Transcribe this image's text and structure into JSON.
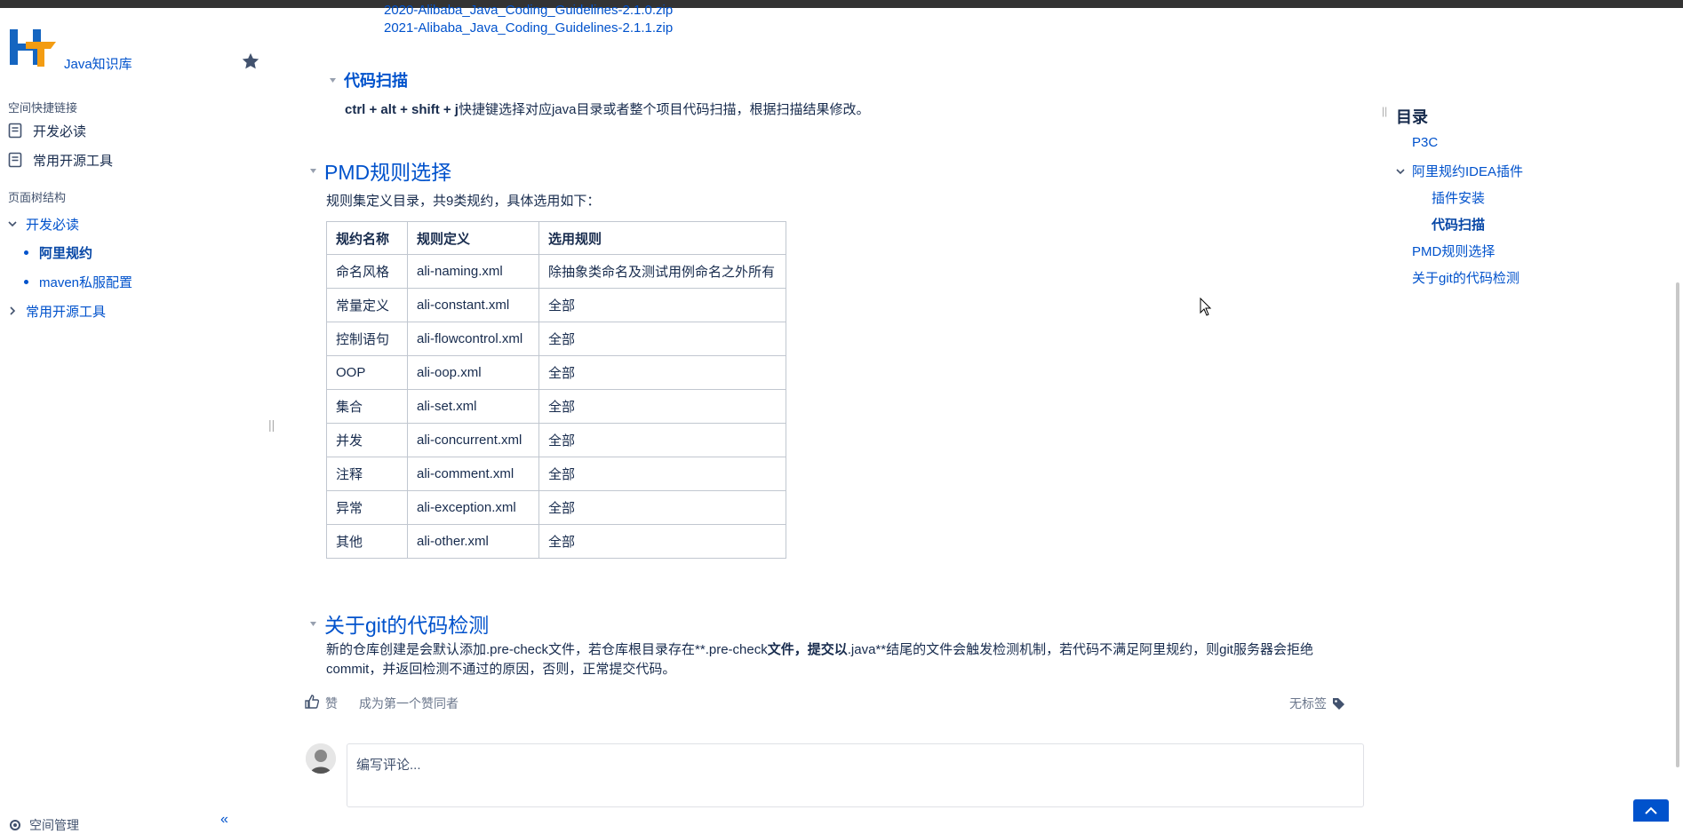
{
  "space": {
    "name": "Java知识库",
    "favorite_icon": "star-icon"
  },
  "sidebar": {
    "quick_links_title": "空间快捷链接",
    "quick_links": [
      {
        "label": "开发必读",
        "icon": "page-icon"
      },
      {
        "label": "常用开源工具",
        "icon": "page-icon"
      }
    ],
    "tree_title": "页面树结构",
    "tree": [
      {
        "label": "开发必读",
        "expanded": true
      },
      {
        "label": "阿里规约",
        "active": true
      },
      {
        "label": "maven私服配置"
      },
      {
        "label": "常用开源工具",
        "expanded": false
      }
    ],
    "footer_label": "空间管理"
  },
  "content": {
    "attachments": [
      "2020-Alibaba_Java_Coding_Guidelines-2.1.0.zip",
      "2021-Alibaba_Java_Coding_Guidelines-2.1.1.zip"
    ],
    "code_scan_heading": "代码扫描",
    "code_scan_keys": "ctrl + alt + shift + j",
    "code_scan_text": "快捷键选择对应java目录或者整个项目代码扫描，根据扫描结果修改。",
    "pmd_heading": "PMD规则选择",
    "pmd_intro": "规则集定义目录，共9类规约，具体选用如下：",
    "table": {
      "headers": [
        "规约名称",
        "规则定义",
        "选用规则"
      ],
      "rows": [
        [
          "命名风格",
          "ali-naming.xml",
          "除抽象类命名及测试用例命名之外所有"
        ],
        [
          "常量定义",
          "ali-constant.xml",
          "全部"
        ],
        [
          "控制语句",
          "ali-flowcontrol.xml",
          "全部"
        ],
        [
          "OOP",
          "ali-oop.xml",
          "全部"
        ],
        [
          "集合",
          "ali-set.xml",
          "全部"
        ],
        [
          "并发",
          "ali-concurrent.xml",
          "全部"
        ],
        [
          "注释",
          "ali-comment.xml",
          "全部"
        ],
        [
          "异常",
          "ali-exception.xml",
          "全部"
        ],
        [
          "其他",
          "ali-other.xml",
          "全部"
        ]
      ]
    },
    "git_heading": "关于git的代码检测",
    "git_text_1": "新的仓库创建是会默认添加.pre-check文件，若仓库根目录存在**.pre-check",
    "git_text_bold": "文件，提交以",
    "git_text_2": ".java**结尾的文件会触发检测机制，若代码不满足阿里规约，则git服务器会拒绝",
    "git_text_3": "commit，并返回检测不通过的原因，否则，正常提交代码。"
  },
  "footer": {
    "like_label": "赞",
    "like_first": "成为第一个赞同者",
    "labels_text": "无标签",
    "comment_placeholder": "编写评论..."
  },
  "toc": {
    "title": "目录",
    "items": [
      {
        "label": "P3C"
      },
      {
        "label": "阿里规约IDEA插件",
        "expanded": true
      },
      {
        "label": "插件安装"
      },
      {
        "label": "代码扫描",
        "active": true
      },
      {
        "label": "PMD规则选择"
      },
      {
        "label": "关于git的代码检测"
      }
    ]
  },
  "colors": {
    "accent": "#0052cc",
    "text": "#172b4d",
    "logo_blue": "#1565c0",
    "logo_orange": "#f39c12"
  }
}
